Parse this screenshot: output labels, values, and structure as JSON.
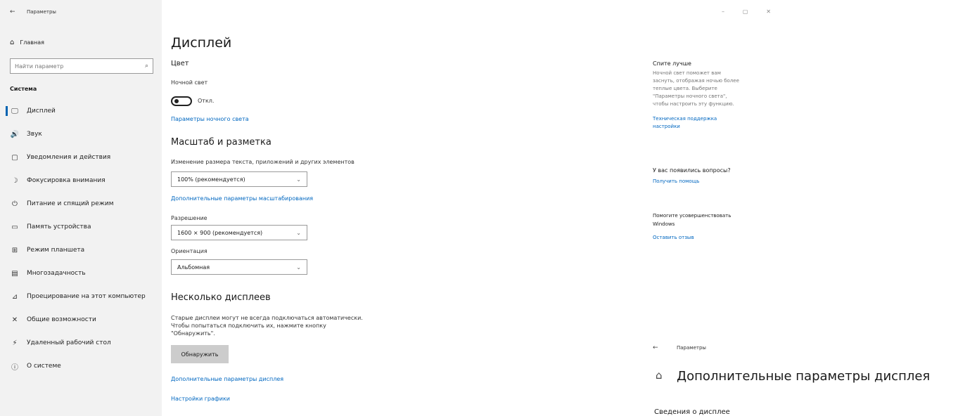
{
  "window": {
    "title": "Параметры",
    "controls": [
      "–",
      "▢",
      "✕"
    ]
  },
  "nav": {
    "home_label": "Главная",
    "search_placeholder": "Найти параметр",
    "section": "Система",
    "items": [
      {
        "label": "Дисплей",
        "icon": "display-icon",
        "glyph": "🖵"
      },
      {
        "label": "Звук",
        "icon": "sound-icon",
        "glyph": "🔊"
      },
      {
        "label": "Уведомления и действия",
        "icon": "notifications-icon",
        "glyph": "▢"
      },
      {
        "label": "Фокусировка внимания",
        "icon": "focus-assist-icon",
        "glyph": "☽"
      },
      {
        "label": "Питание и спящий режим",
        "icon": "power-icon",
        "glyph": "⏻"
      },
      {
        "label": "Память устройства",
        "icon": "storage-icon",
        "glyph": "▭"
      },
      {
        "label": "Режим планшета",
        "icon": "tablet-icon",
        "glyph": "⊞"
      },
      {
        "label": "Многозадачность",
        "icon": "multitasking-icon",
        "glyph": "▤"
      },
      {
        "label": "Проецирование на этот компьютер",
        "icon": "projecting-icon",
        "glyph": "⊿"
      },
      {
        "label": "Общие возможности",
        "icon": "shared-experiences-icon",
        "glyph": "✕"
      },
      {
        "label": "Удаленный рабочий стол",
        "icon": "remote-desktop-icon",
        "glyph": "⚡"
      },
      {
        "label": "О системе",
        "icon": "about-icon",
        "glyph": "ⓘ"
      }
    ]
  },
  "main": {
    "title": "Дисплей",
    "color_header": "Цвет",
    "night_light_label": "Ночной свет",
    "night_light_state": "Откл.",
    "night_light_link": "Параметры ночного света",
    "scale_header": "Масштаб и разметка",
    "scale_label": "Изменение размера текста, приложений и других элементов",
    "scale_value": "100% (рекомендуется)",
    "scale_link": "Дополнительные параметры масштабирования",
    "resolution_label": "Разрешение",
    "resolution_value": "1600 × 900 (рекомендуется)",
    "orientation_label": "Ориентация",
    "orientation_value": "Альбомная",
    "multi_header": "Несколько дисплеев",
    "multi_text_1": "Старые дисплеи могут не всегда подключаться автоматически.",
    "multi_text_2": "Чтобы попытаться подключить их, нажмите кнопку",
    "multi_text_3": "\"Обнаружить\".",
    "detect_button": "Обнаружить",
    "advanced_link": "Дополнительные параметры дисплея",
    "graphics_link": "Настройки графики"
  },
  "side": {
    "sleep_title": "Спите лучше",
    "sleep_text_1": "Ночной свет поможет вам",
    "sleep_text_2": "заснуть, отображая ночью более",
    "sleep_text_3": "теплые цвета. Выберите",
    "sleep_text_4": "\"Параметры ночного света\",",
    "sleep_text_5": "чтобы настроить эту функцию.",
    "support_link_1": "Техническая поддержка",
    "support_link_2": "настройки",
    "questions_title": "У вас появились вопросы?",
    "help_link": "Получить помощь",
    "improve_title_1": "Помогите усовершенствовать",
    "improve_title_2": "Windows",
    "feedback_link": "Оставить отзыв"
  },
  "overlay": {
    "back_label": "Параметры",
    "title": "Дополнительные параметры дисплея",
    "subtitle": "Сведения о дисплее"
  }
}
